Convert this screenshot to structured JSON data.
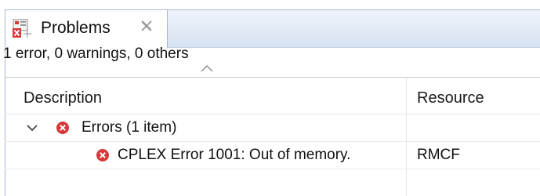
{
  "tab": {
    "label": "Problems",
    "icon": "problems-view-icon",
    "close_icon": "close-icon"
  },
  "status": "1 error, 0 warnings, 0 others",
  "columns": {
    "description": "Description",
    "resource": "Resource"
  },
  "groups": [
    {
      "label": "Errors (1 item)",
      "expanded": true,
      "items": [
        {
          "description": "CPLEX Error  1001: Out of memory.",
          "resource": "RMCF"
        }
      ]
    }
  ],
  "colors": {
    "error_red": "#d9383a",
    "tab_strip": "#dce6f3",
    "border": "#a7b7cf"
  }
}
